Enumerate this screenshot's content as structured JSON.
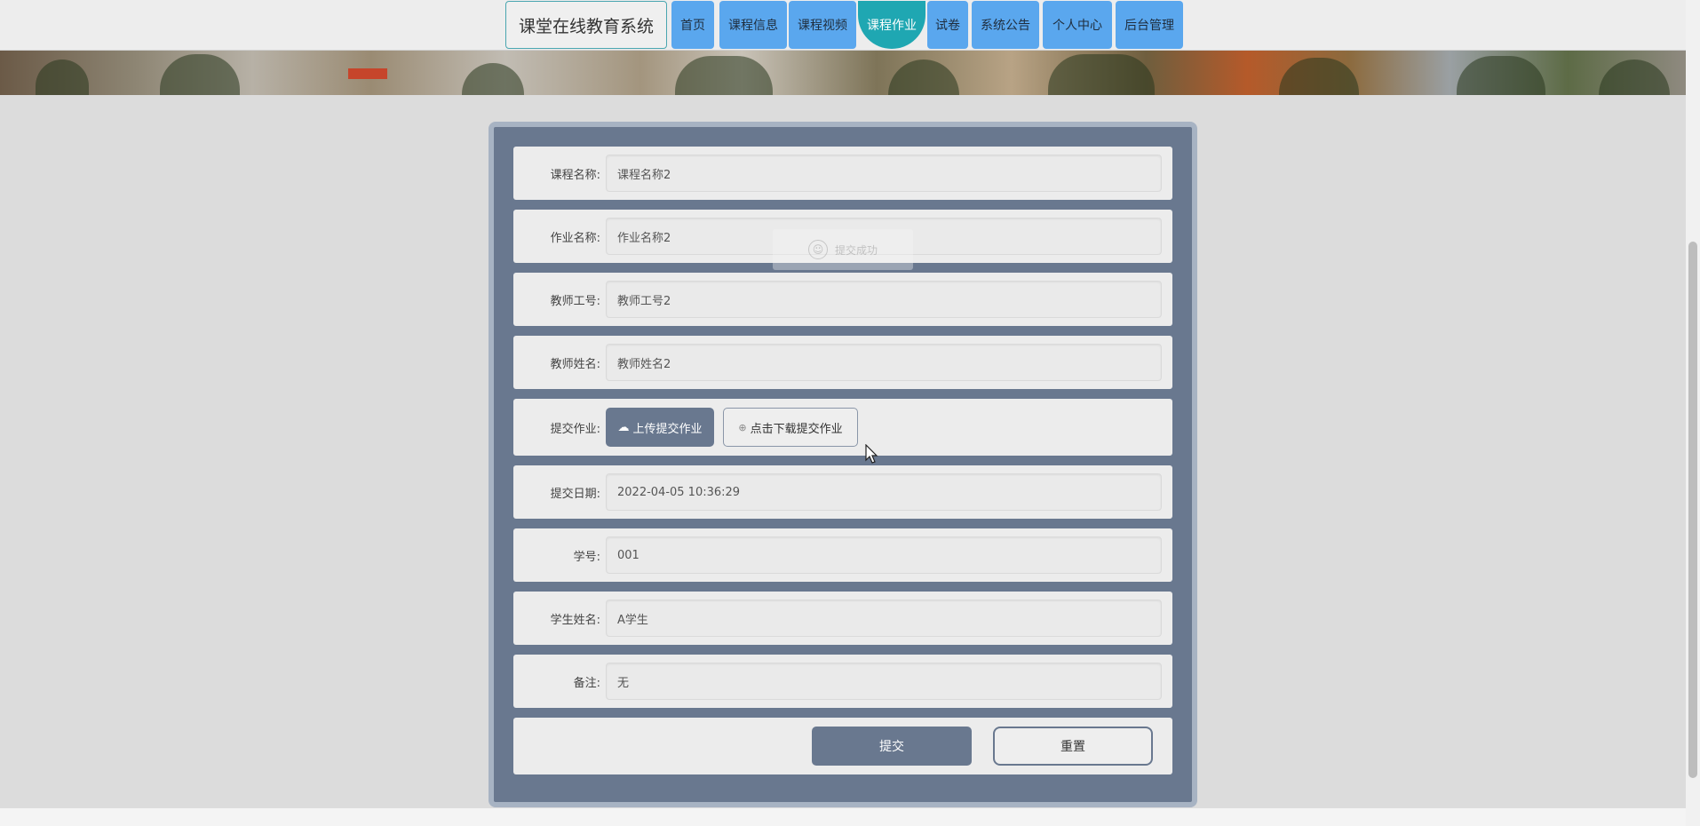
{
  "header": {
    "brand": "课堂在线教育系统",
    "nav": [
      {
        "label": "首页",
        "active": false
      },
      {
        "label": "课程信息",
        "active": false
      },
      {
        "label": "课程视频",
        "active": false
      },
      {
        "label": "课程作业",
        "active": true
      },
      {
        "label": "试卷",
        "active": false
      },
      {
        "label": "系统公告",
        "active": false
      },
      {
        "label": "个人中心",
        "active": false
      },
      {
        "label": "后台管理",
        "active": false
      }
    ]
  },
  "toast": {
    "text": "提交成功",
    "icon": "smile-icon"
  },
  "form": {
    "fields": [
      {
        "label": "课程名称:",
        "value": "课程名称2"
      },
      {
        "label": "作业名称:",
        "value": "作业名称2"
      },
      {
        "label": "教师工号:",
        "value": "教师工号2"
      },
      {
        "label": "教师姓名:",
        "value": "教师姓名2"
      }
    ],
    "upload": {
      "label": "提交作业:",
      "upload_button": "上传提交作业",
      "download_button": "点击下载提交作业"
    },
    "fields2": [
      {
        "label": "提交日期:",
        "value": "2022-04-05 10:36:29"
      },
      {
        "label": "学号:",
        "value": "001"
      },
      {
        "label": "学生姓名:",
        "value": "A学生"
      },
      {
        "label": "备注:",
        "value": "无"
      }
    ],
    "submit_label": "提交",
    "reset_label": "重置"
  },
  "colors": {
    "nav": "#5aa7ee",
    "nav_active": "#1fa7b2",
    "panel": "#69788f"
  }
}
